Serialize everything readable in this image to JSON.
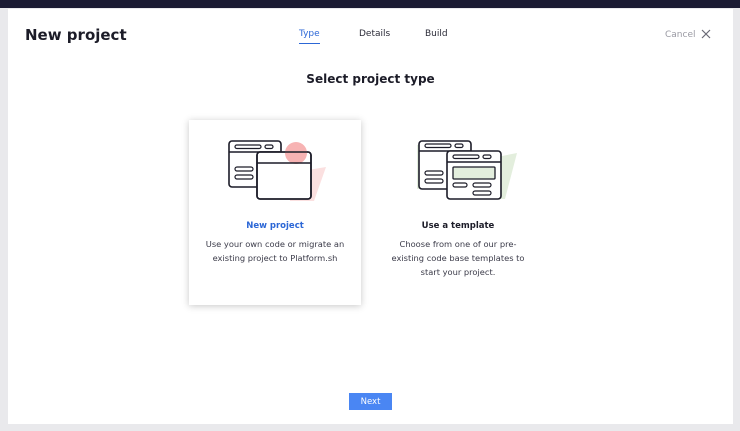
{
  "modal": {
    "title": "New project",
    "cancel_label": "Cancel",
    "close_icon": "close-icon"
  },
  "tabs": [
    {
      "label": "Type",
      "active": true
    },
    {
      "label": "Details",
      "active": false
    },
    {
      "label": "Build",
      "active": false
    }
  ],
  "heading": "Select project type",
  "options": [
    {
      "title": "New project",
      "description": "Use your own code or migrate an existing project to Platform.sh",
      "selected": true,
      "icon": "new-project-illustration-icon"
    },
    {
      "title": "Use a template",
      "description": "Choose from one of our pre-existing code base templates to start your project.",
      "selected": false,
      "icon": "template-illustration-icon"
    }
  ],
  "footer": {
    "next_label": "Next"
  },
  "colors": {
    "accent": "#2c67d6",
    "button": "#4a86f3",
    "illustration_pink": "#f7b3b3",
    "illustration_green": "#e3eedd"
  }
}
